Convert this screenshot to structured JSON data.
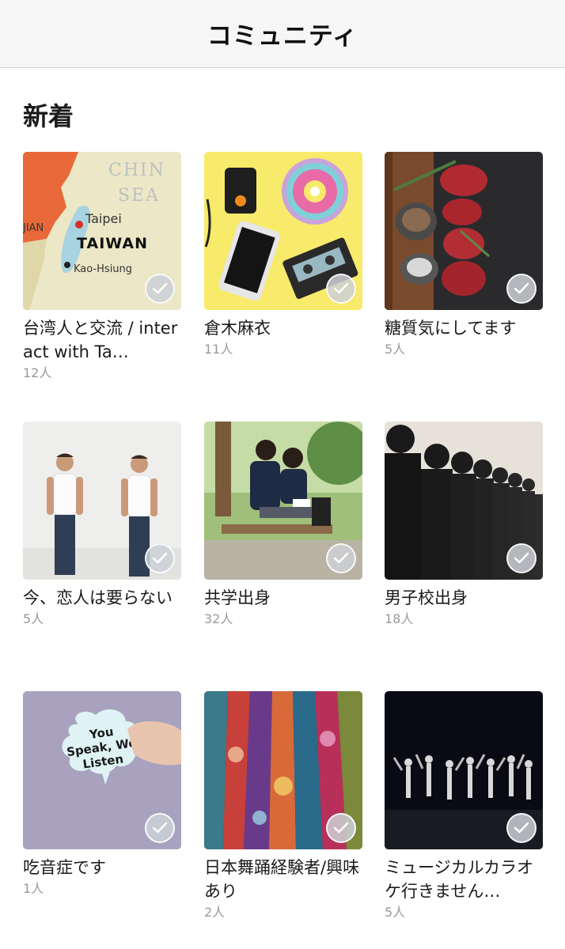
{
  "header": {
    "title": "コミュニティ"
  },
  "section": {
    "title": "新着"
  },
  "communities": [
    {
      "name": "台湾人と交流 / interact with Ta…",
      "count": "12人",
      "image": "taiwan-map"
    },
    {
      "name": "倉木麻衣",
      "count": "11人",
      "image": "music-items"
    },
    {
      "name": "糖質気にしてます",
      "count": "5人",
      "image": "steak-meat"
    },
    {
      "name": "今、恋人は要らない",
      "count": "5人",
      "image": "two-men-wall"
    },
    {
      "name": "共学出身",
      "count": "32人",
      "image": "students-bench"
    },
    {
      "name": "男子校出身",
      "count": "18人",
      "image": "boys-uniform-line"
    },
    {
      "name": "吃音症です",
      "count": "1人",
      "image": "speech-bubble",
      "bubble_text": [
        "You",
        "Speak, We",
        "Listen"
      ]
    },
    {
      "name": "日本舞踊経験者/興味あり",
      "count": "2人",
      "image": "kimono-fabrics"
    },
    {
      "name": "ミュージカルカラオケ行きません…",
      "count": "5人",
      "image": "dance-stage"
    }
  ],
  "map_labels": {
    "sea1": "CHIN",
    "sea2": "SEA",
    "city1": "Taipei",
    "country": "TAIWAN",
    "city2": "Kao-Hsiung",
    "left": "JIAN"
  },
  "colors": {
    "header_bg": "#f6f6f6",
    "count_text": "#9a9a9a",
    "check_bg": "#cdd0d6"
  }
}
